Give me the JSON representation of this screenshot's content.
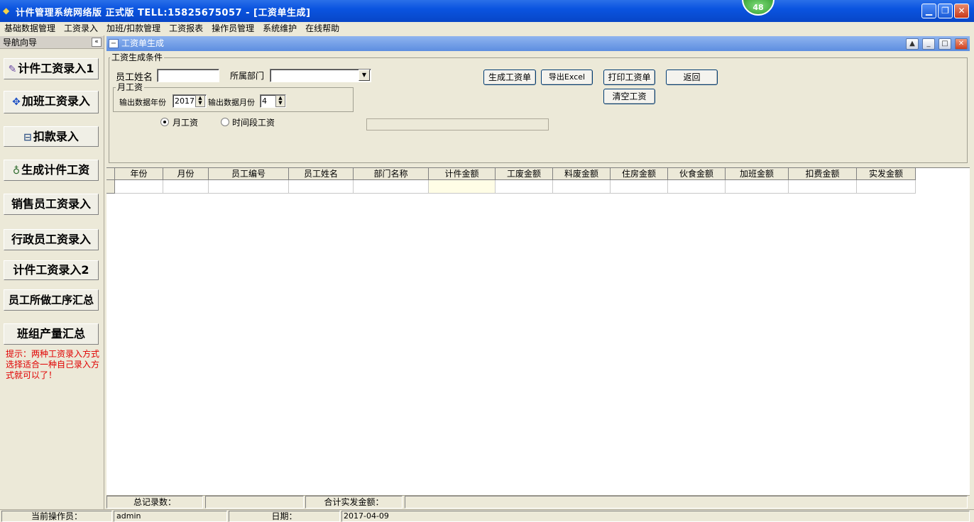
{
  "window": {
    "title": "计件管理系统网络版  正式版  TELL:15825675057 - [工资单生成]",
    "badge": "48"
  },
  "menu": [
    "基础数据管理",
    "工资录入",
    "加班/扣款管理",
    "工资报表",
    "操作员管理",
    "系统维护",
    "在线帮助"
  ],
  "nav": {
    "header": "导航向导",
    "collapse": "«",
    "items": [
      {
        "label": "计件工资录入1",
        "icon": "document-edit-icon"
      },
      {
        "label": "加班工资录入",
        "icon": "arrows-icon"
      },
      {
        "label": "扣款录入",
        "icon": "money-icon"
      },
      {
        "label": "生成计件工资",
        "icon": "money-bag-icon"
      },
      {
        "label": "销售员工资录入"
      },
      {
        "label": "行政员工资录入"
      },
      {
        "label": "计件工资录入2"
      },
      {
        "label": "员工所做工序汇总"
      },
      {
        "label": "班组产量汇总"
      }
    ],
    "hint": "提示：两种工资录入方式选择适合一种自己录入方式就可以了！"
  },
  "child": {
    "title": "工资单生成"
  },
  "conditions": {
    "legend": "工资生成条件",
    "employee_name_label": "员工姓名",
    "employee_name_value": "",
    "department_label": "所属部门",
    "department_value": "",
    "monthly_legend": "月工资",
    "year_label": "输出数据年份",
    "year_value": "2017",
    "month_label": "输出数据月份",
    "month_value": "4",
    "radio_monthly": "月工资",
    "radio_monthly_checked": true,
    "radio_period": "时间段工资",
    "buttons": {
      "generate": "生成工资单",
      "export": "导出Excel",
      "print": "打印工资单",
      "back": "返回",
      "clear": "清空工资"
    }
  },
  "grid": {
    "columns": [
      "年份",
      "月份",
      "员工编号",
      "员工姓名",
      "部门名称",
      "计件金额",
      "工废金额",
      "料废金额",
      "住房金额",
      "伙食金额",
      "加班金额",
      "扣费金额",
      "实发金额"
    ],
    "rows": [
      [
        "",
        "",
        "",
        "",
        "",
        "",
        "",
        "",
        "",
        "",
        "",
        "",
        ""
      ]
    ]
  },
  "summary": {
    "total_records_label": "总记录数：",
    "total_records_value": "",
    "total_pay_label": "合计实发金额：",
    "total_pay_value": ""
  },
  "status": {
    "operator_label": "当前操作员：",
    "operator_value": "admin",
    "date_label": "日期：",
    "date_value": "2017-04-09"
  }
}
